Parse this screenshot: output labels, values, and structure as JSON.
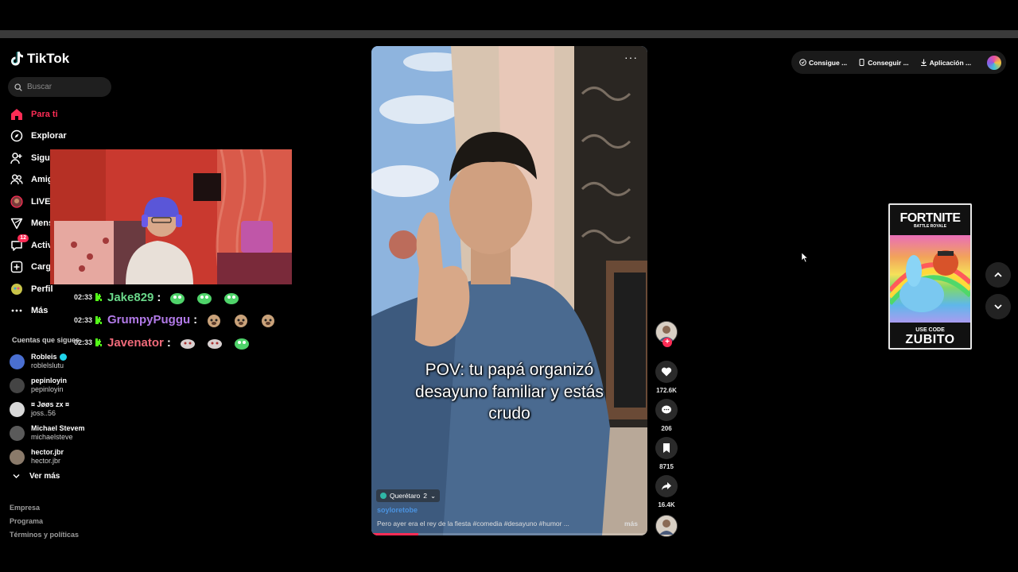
{
  "app": {
    "logo_text": "TikTok"
  },
  "search": {
    "placeholder": "Buscar"
  },
  "nav": {
    "items": [
      {
        "label": "Para ti",
        "icon": "home-icon",
        "active": true
      },
      {
        "label": "Explorar",
        "icon": "compass-icon"
      },
      {
        "label": "Siguiendo",
        "icon": "following-icon"
      },
      {
        "label": "Amigos",
        "icon": "friends-icon"
      },
      {
        "label": "LIVE",
        "icon": "live-icon"
      },
      {
        "label": "Mensajes",
        "icon": "messages-icon"
      },
      {
        "label": "Actividad",
        "icon": "activity-icon",
        "badge": "12"
      },
      {
        "label": "Cargar",
        "icon": "upload-icon"
      },
      {
        "label": "Perfil",
        "icon": "profile-icon"
      },
      {
        "label": "Más",
        "icon": "more-icon"
      }
    ]
  },
  "following": {
    "heading": "Cuentas que sigues",
    "accounts": [
      {
        "name": "Robleis",
        "user": "roblelslutu",
        "verified": true,
        "color": "#4a6fd1"
      },
      {
        "name": "pepinloyin",
        "user": "pepinloyin",
        "color": "#444444"
      },
      {
        "name": "¤ Jøøs zx ¤",
        "user": "joss..56",
        "color": "#d8d8d8"
      },
      {
        "name": "Michael Stevem",
        "user": "michaelsteve",
        "color": "#5a5a5a"
      },
      {
        "name": "hector.jbr",
        "user": "hector.jbr",
        "color": "#8a7a6a"
      }
    ],
    "see_more": "Ver más"
  },
  "footer": {
    "links": [
      "Empresa",
      "Programa",
      "Términos y políticas"
    ]
  },
  "stream_chat": [
    {
      "time": "02:33",
      "user": "Jake829",
      "color": "#6ad88a"
    },
    {
      "time": "02:33",
      "user": "GrumpyPuggu",
      "color": "#b27ae8"
    },
    {
      "time": "02:33",
      "user": "Javenator",
      "color": "#f06a7a"
    }
  ],
  "video": {
    "caption": "POV: tu papá organizó desayuno familiar y estás crudo",
    "location": "Querétaro",
    "location_count": "2",
    "author": "soyloretobe",
    "description": "Pero ayer era el rey de la fiesta #comedia  #desayuno  #humor  ...",
    "more_label": "más",
    "progress": 0.17,
    "menu": "···"
  },
  "actions": {
    "likes": "172.6K",
    "comments": "206",
    "saves": "8715",
    "shares": "16.4K"
  },
  "top_actions": [
    {
      "label": "Consigue ...",
      "icon": "coin-icon"
    },
    {
      "label": "Conseguir ...",
      "icon": "phone-icon"
    },
    {
      "label": "Aplicación ...",
      "icon": "download-icon"
    }
  ],
  "ad": {
    "title": "FORTNITE",
    "subtitle": "BATTLE ROYALE",
    "use_code": "USE CODE",
    "code": "ZUBITO"
  },
  "colors": {
    "accent": "#fe2c55",
    "background": "#000000",
    "verified": "#20d5ec"
  }
}
